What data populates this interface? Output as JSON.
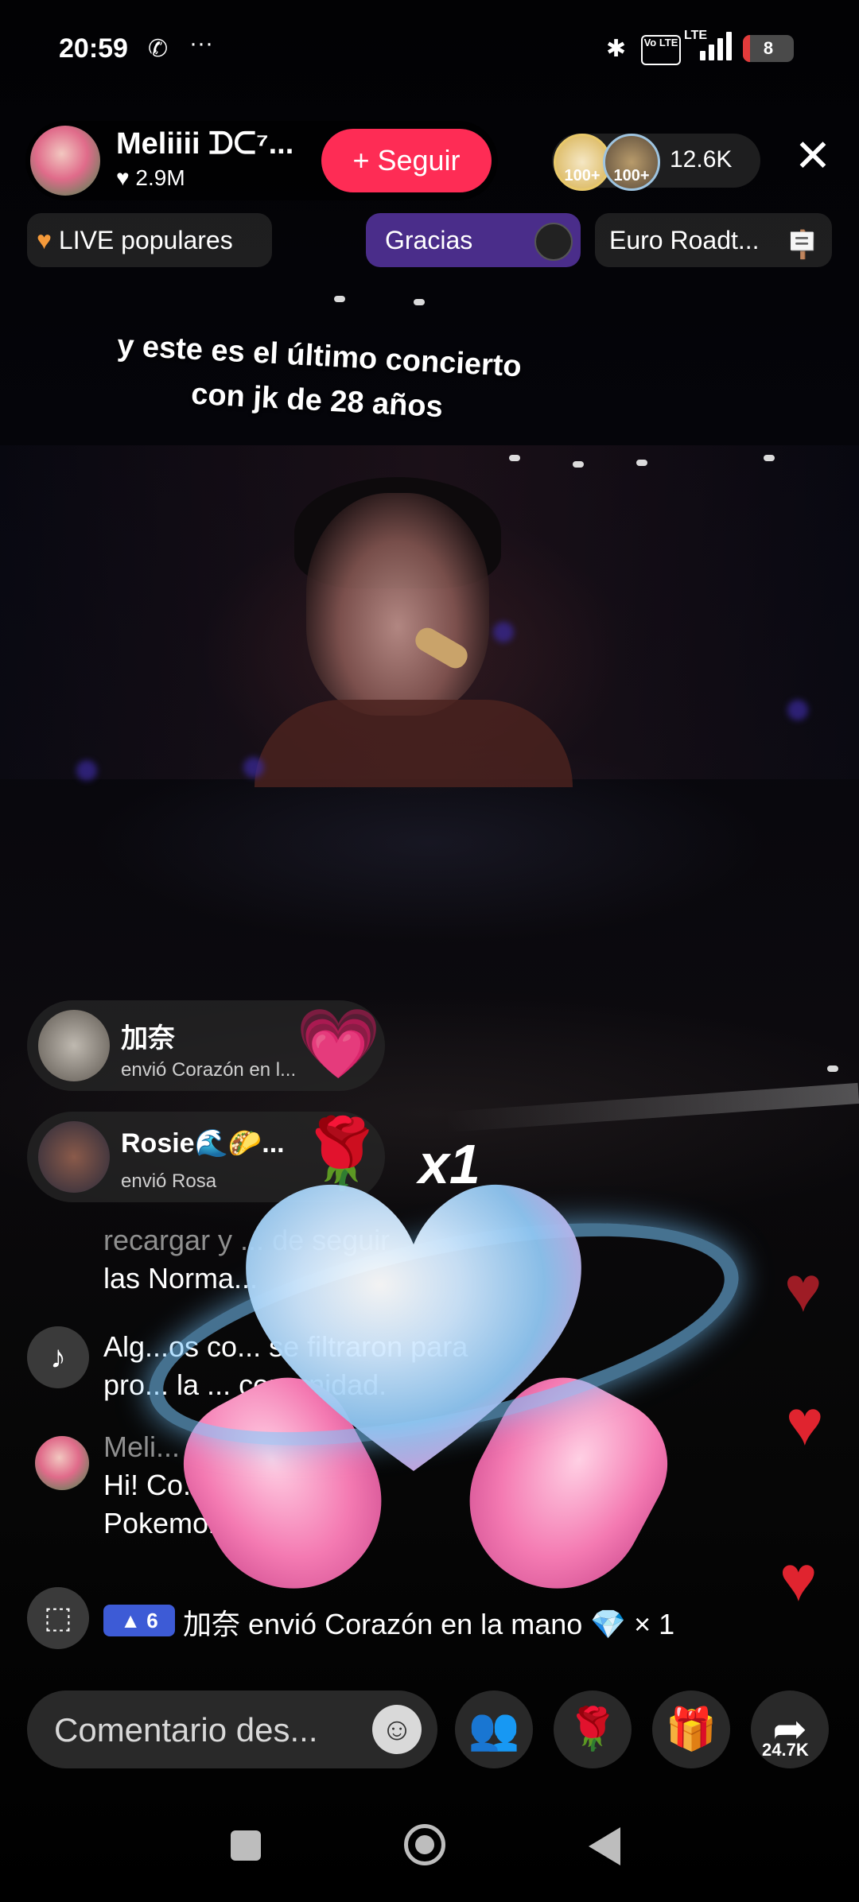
{
  "status_bar": {
    "time": "20:59",
    "battery": "8",
    "network": "LTE",
    "volte": "Vo LTE",
    "more": "···"
  },
  "host": {
    "name": "Meliiii ᗪᑕ⁷...",
    "likes": "♥ 2.9M",
    "follow_label": "+ Seguir"
  },
  "viewers": {
    "badges": [
      "100+",
      "100+"
    ],
    "count": "12.6K"
  },
  "chips": {
    "popular": "LIVE populares",
    "thanks": "Gracias",
    "event": "Euro Roadt..."
  },
  "caption": {
    "line1": "y este es el último concierto",
    "line2": "con jk de 28 años"
  },
  "gift_notifications": [
    {
      "user": "加奈",
      "description": "envió Corazón en l..."
    },
    {
      "user": "Rosie🌊🌮...",
      "description": "envió Rosa"
    }
  ],
  "gift_multiplier": "x1",
  "chat": {
    "system_line1": "recargar y ... de seguir",
    "system_line2": "las Norma...",
    "moderation_line1": "Alg...os co... se filtraron para",
    "moderation_line2": "pro... la ... comunidad.",
    "user_name": "Meli...",
    "user_line1": "Hi! Co... Lets t... &",
    "user_line2": "Pokemon..."
  },
  "gift_ticker": {
    "level": "6",
    "text": "加奈 envió Corazón en la mano 💎 × 1"
  },
  "bottom_bar": {
    "comment_placeholder": "Comentario des...",
    "share_count": "24.7K"
  },
  "colors": {
    "accent": "#fe2c55",
    "purple_chip": "#4a2d8a",
    "level_badge": "#3d5bd6",
    "heart": "#e0242f"
  }
}
